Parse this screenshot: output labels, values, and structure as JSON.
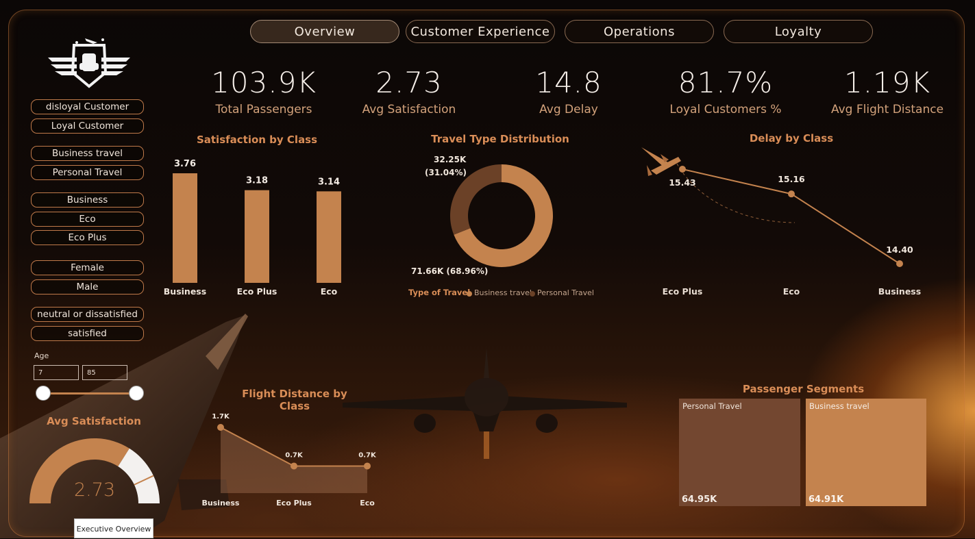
{
  "nav": {
    "tabs": [
      "Overview",
      "Customer Experience",
      "Operations",
      "Loyalty"
    ],
    "active": "Overview"
  },
  "filters": {
    "customer_type": [
      "disloyal Customer",
      "Loyal Customer"
    ],
    "travel_type": [
      "Business travel",
      "Personal Travel"
    ],
    "class": [
      "Business",
      "Eco",
      "Eco Plus"
    ],
    "gender": [
      "Female",
      "Male"
    ],
    "satisfaction": [
      "neutral or dissatisfied",
      "satisfied"
    ],
    "age": {
      "label": "Age",
      "min": "7",
      "max": "85"
    }
  },
  "kpis": [
    {
      "value": "103.9K",
      "label": "Total Passengers"
    },
    {
      "value": "2.73",
      "label": "Avg Satisfaction"
    },
    {
      "value": "14.8",
      "label": "Avg Delay"
    },
    {
      "value": "81.7%",
      "label": "Loyal Customers %"
    },
    {
      "value": "1.19K",
      "label": "Avg Flight Distance"
    }
  ],
  "chart_data": [
    {
      "type": "bar",
      "title": "Satisfaction by Class",
      "categories": [
        "Business",
        "Eco Plus",
        "Eco"
      ],
      "values": [
        3.76,
        3.18,
        3.14
      ],
      "value_labels": [
        "3.76",
        "3.18",
        "3.14"
      ]
    },
    {
      "type": "pie",
      "title": "Travel Type Distribution",
      "legend_title": "Type of Travel",
      "categories": [
        "Business travel",
        "Personal Travel"
      ],
      "values": [
        71.66,
        32.25
      ],
      "value_labels": [
        "71.66K (68.96%)",
        "32.25K (31.04%)"
      ],
      "colors": [
        "#c4834e",
        "#6b4127"
      ]
    },
    {
      "type": "line",
      "title": "Delay by Class",
      "categories": [
        "Eco Plus",
        "Eco",
        "Business"
      ],
      "values": [
        15.43,
        15.16,
        14.4
      ],
      "value_labels": [
        "15.43",
        "15.16",
        "14.40"
      ]
    },
    {
      "type": "area",
      "title": "Flight Distance by Class",
      "categories": [
        "Business",
        "Eco Plus",
        "Eco"
      ],
      "values": [
        1.7,
        0.7,
        0.7
      ],
      "value_labels": [
        "1.7K",
        "0.7K",
        "0.7K"
      ]
    },
    {
      "type": "treemap",
      "title": "Passenger Segments",
      "categories": [
        "Personal Travel",
        "Business travel"
      ],
      "values": [
        64.95,
        64.91
      ],
      "value_labels": [
        "64.95K",
        "64.91K"
      ],
      "colors": [
        "#734730",
        "#c4834e"
      ]
    },
    {
      "type": "gauge",
      "title": "Avg Satisfaction",
      "value": 2.73,
      "value_label": "2.73",
      "fill_fraction": 0.68
    }
  ],
  "tooltip": "Executive Overview",
  "colors": {
    "accent": "#c4834e",
    "dark_accent": "#6b4127",
    "title": "#d98d57"
  }
}
